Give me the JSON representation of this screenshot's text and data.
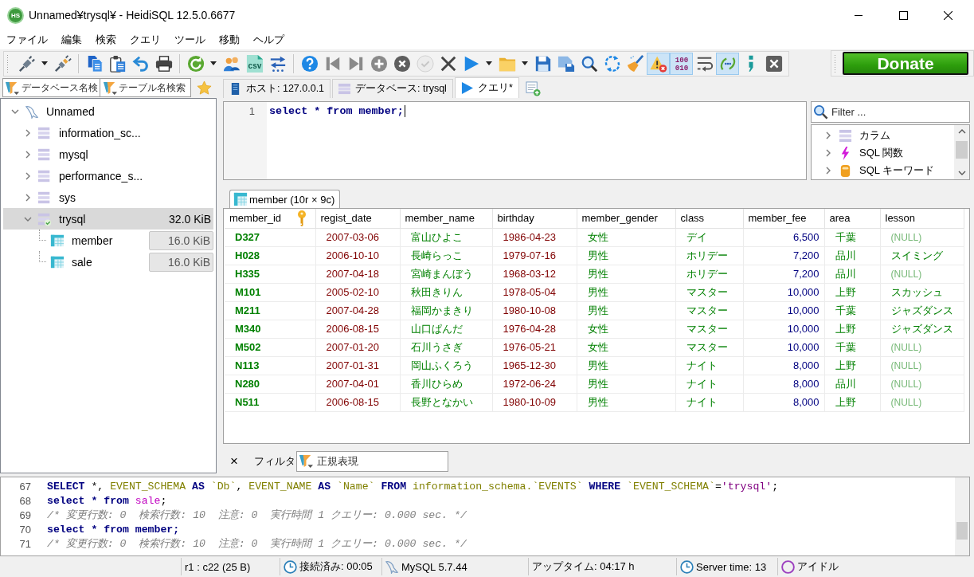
{
  "window": {
    "logo_text": "HS",
    "title": "Unnamed¥trysql¥ - HeidiSQL 12.5.0.6677"
  },
  "menu": [
    "ファイル",
    "編集",
    "検索",
    "クエリ",
    "ツール",
    "移動",
    "ヘルプ"
  ],
  "toolbar": {
    "groups": [
      [
        {
          "on": false,
          "disabled": false,
          "dropdown": true
        },
        {
          "on": false,
          "disabled": false,
          "dropdown": false
        }
      ],
      [
        {
          "on": false,
          "disabled": false,
          "dropdown": false
        },
        {
          "on": false,
          "disabled": false,
          "dropdown": false
        },
        {
          "on": false,
          "disabled": false,
          "dropdown": false
        },
        {
          "on": false,
          "disabled": false,
          "dropdown": false
        }
      ],
      [
        {
          "on": false,
          "disabled": false,
          "dropdown": true
        },
        {
          "on": false,
          "disabled": false,
          "dropdown": false
        },
        {
          "on": false,
          "disabled": false,
          "dropdown": false,
          "text_lines": [
            "csv"
          ]
        },
        {
          "on": false,
          "disabled": false,
          "dropdown": false
        }
      ],
      [
        {
          "on": false,
          "disabled": false,
          "dropdown": false
        },
        {
          "on": false,
          "disabled": false,
          "dropdown": false
        },
        {
          "on": false,
          "disabled": false,
          "dropdown": false
        },
        {
          "on": false,
          "disabled": false,
          "dropdown": false
        },
        {
          "on": false,
          "disabled": false,
          "dropdown": false
        },
        {
          "on": false,
          "disabled": true,
          "dropdown": false
        },
        {
          "on": false,
          "disabled": false,
          "dropdown": false
        },
        {
          "on": false,
          "disabled": false,
          "dropdown": true
        },
        {
          "on": false,
          "disabled": false,
          "dropdown": true
        },
        {
          "on": false,
          "disabled": false,
          "dropdown": false
        },
        {
          "on": false,
          "disabled": false,
          "dropdown": false
        },
        {
          "on": false,
          "disabled": false,
          "dropdown": false
        },
        {
          "on": false,
          "disabled": false,
          "dropdown": false
        },
        {
          "on": false,
          "disabled": false,
          "dropdown": false
        },
        {
          "on": true,
          "disabled": false,
          "dropdown": false
        },
        {
          "on": true,
          "disabled": false,
          "dropdown": false,
          "text_lines": [
            "100",
            "010"
          ]
        },
        {
          "on": false,
          "disabled": false,
          "dropdown": false
        },
        {
          "on": true,
          "disabled": false,
          "dropdown": false
        },
        {
          "on": false,
          "disabled": false,
          "dropdown": false
        },
        {
          "on": false,
          "disabled": false,
          "dropdown": false
        }
      ]
    ],
    "donate": "Donate"
  },
  "tree_filters": [
    {
      "placeholder": "データベース名検"
    },
    {
      "placeholder": "テーブル名検索"
    }
  ],
  "tabs": [
    {
      "kind": "host",
      "label": "ホスト: 127.0.0.1",
      "selected": false
    },
    {
      "kind": "database",
      "label": "データベース: trysql",
      "selected": false
    },
    {
      "kind": "query",
      "label": "クエリ*",
      "selected": true
    }
  ],
  "tree": {
    "kind": "server",
    "label": "Unnamed",
    "expanded": true,
    "selected": false,
    "children": [
      {
        "kind": "database",
        "label": "information_sc...",
        "expanded": false,
        "selected": false,
        "active": false
      },
      {
        "kind": "database",
        "label": "mysql",
        "expanded": false,
        "selected": false,
        "active": false
      },
      {
        "kind": "database",
        "label": "performance_s...",
        "expanded": false,
        "selected": false,
        "active": false
      },
      {
        "kind": "database",
        "label": "sys",
        "expanded": false,
        "selected": false,
        "active": false
      },
      {
        "kind": "database",
        "label": "trysql",
        "size": "32.0 KiB",
        "expanded": true,
        "selected": true,
        "active": true,
        "children": [
          {
            "kind": "table",
            "label": "member",
            "size": "16.0 KiB",
            "selected": false
          },
          {
            "kind": "table",
            "label": "sale",
            "size": "16.0 KiB",
            "selected": false
          }
        ]
      }
    ]
  },
  "editor": {
    "lines": [
      {
        "number": "1",
        "text": "select * from member;"
      }
    ]
  },
  "helper": {
    "filter": {
      "placeholder": "Filter ..."
    },
    "items": [
      {
        "kind": "columns",
        "label": "カラム",
        "expanded": false
      },
      {
        "kind": "functions",
        "label": "SQL 関数",
        "expanded": false
      },
      {
        "kind": "keywords",
        "label": "SQL キーワード",
        "expanded": false
      }
    ]
  },
  "results": {
    "tabs": [
      {
        "label": "member (10r × 9c)",
        "selected": true
      }
    ],
    "columns": [
      {
        "label": "member_id",
        "kind": "text",
        "primary_key": true
      },
      {
        "label": "regist_date",
        "kind": "date",
        "primary_key": false
      },
      {
        "label": "member_name",
        "kind": "text",
        "primary_key": false
      },
      {
        "label": "birthday",
        "kind": "date",
        "primary_key": false
      },
      {
        "label": "member_gender",
        "kind": "text",
        "primary_key": false
      },
      {
        "label": "class",
        "kind": "text",
        "primary_key": false
      },
      {
        "label": "member_fee",
        "kind": "number",
        "primary_key": false
      },
      {
        "label": "area",
        "kind": "text",
        "primary_key": false
      },
      {
        "label": "lesson",
        "kind": "text",
        "primary_key": false
      }
    ],
    "rows": [
      {
        "cells": [
          "D327",
          "2007-03-06",
          "富山ひよこ",
          "1986-04-23",
          "女性",
          "デイ",
          "6,500",
          "千葉",
          "(NULL)"
        ],
        "null": [
          false,
          false,
          false,
          false,
          false,
          false,
          false,
          false,
          true
        ]
      },
      {
        "cells": [
          "H028",
          "2006-10-10",
          "長崎らっこ",
          "1979-07-16",
          "男性",
          "ホリデー",
          "7,200",
          "品川",
          "スイミング"
        ],
        "null": [
          false,
          false,
          false,
          false,
          false,
          false,
          false,
          false,
          false
        ]
      },
      {
        "cells": [
          "H335",
          "2007-04-18",
          "宮崎まんぼう",
          "1968-03-12",
          "男性",
          "ホリデー",
          "7,200",
          "品川",
          "(NULL)"
        ],
        "null": [
          false,
          false,
          false,
          false,
          false,
          false,
          false,
          false,
          true
        ]
      },
      {
        "cells": [
          "M101",
          "2005-02-10",
          "秋田きりん",
          "1978-05-04",
          "男性",
          "マスター",
          "10,000",
          "上野",
          "スカッシュ"
        ],
        "null": [
          false,
          false,
          false,
          false,
          false,
          false,
          false,
          false,
          false
        ]
      },
      {
        "cells": [
          "M211",
          "2007-04-28",
          "福岡かまきり",
          "1980-10-08",
          "男性",
          "マスター",
          "10,000",
          "千葉",
          "ジャズダンス"
        ],
        "null": [
          false,
          false,
          false,
          false,
          false,
          false,
          false,
          false,
          false
        ]
      },
      {
        "cells": [
          "M340",
          "2006-08-15",
          "山口ぱんだ",
          "1976-04-28",
          "女性",
          "マスター",
          "10,000",
          "上野",
          "ジャズダンス"
        ],
        "null": [
          false,
          false,
          false,
          false,
          false,
          false,
          false,
          false,
          false
        ]
      },
      {
        "cells": [
          "M502",
          "2007-01-20",
          "石川うさぎ",
          "1976-05-21",
          "女性",
          "マスター",
          "10,000",
          "千葉",
          "(NULL)"
        ],
        "null": [
          false,
          false,
          false,
          false,
          false,
          false,
          false,
          false,
          true
        ]
      },
      {
        "cells": [
          "N113",
          "2007-01-31",
          "岡山ふくろう",
          "1965-12-30",
          "男性",
          "ナイト",
          "8,000",
          "上野",
          "(NULL)"
        ],
        "null": [
          false,
          false,
          false,
          false,
          false,
          false,
          false,
          false,
          true
        ]
      },
      {
        "cells": [
          "N280",
          "2007-04-01",
          "香川ひらめ",
          "1972-06-24",
          "男性",
          "ナイト",
          "8,000",
          "品川",
          "(NULL)"
        ],
        "null": [
          false,
          false,
          false,
          false,
          false,
          false,
          false,
          false,
          true
        ]
      },
      {
        "cells": [
          "N511",
          "2006-08-15",
          "長野となかい",
          "1980-10-09",
          "男性",
          "ナイト",
          "8,000",
          "上野",
          "(NULL)"
        ],
        "null": [
          false,
          false,
          false,
          false,
          false,
          false,
          false,
          false,
          true
        ]
      }
    ]
  },
  "filter_bar": {
    "close": "×",
    "label": "フィルタ",
    "field": {
      "placeholder": "正規表現"
    }
  },
  "log": {
    "lines": [
      {
        "number": "67",
        "tokens": [
          {
            "kind": "keyword",
            "text": "SELECT"
          },
          {
            "kind": "plain",
            "text": " *, "
          },
          {
            "kind": "identifier",
            "text": "EVENT_SCHEMA"
          },
          {
            "kind": "keyword",
            "text": " AS "
          },
          {
            "kind": "identifier",
            "text": "`Db`"
          },
          {
            "kind": "plain",
            "text": ", "
          },
          {
            "kind": "identifier",
            "text": "EVENT_NAME"
          },
          {
            "kind": "keyword",
            "text": " AS "
          },
          {
            "kind": "identifier",
            "text": "`Name`"
          },
          {
            "kind": "keyword",
            "text": " FROM "
          },
          {
            "kind": "identifier",
            "text": "information_schema.`EVENTS`"
          },
          {
            "kind": "keyword",
            "text": " WHERE "
          },
          {
            "kind": "identifier",
            "text": "`EVENT_SCHEMA`"
          },
          {
            "kind": "plain",
            "text": "="
          },
          {
            "kind": "string",
            "text": "'trysql'"
          },
          {
            "kind": "plain",
            "text": ";"
          }
        ]
      },
      {
        "number": "68",
        "tokens": [
          {
            "kind": "keyword",
            "text": "select * from "
          },
          {
            "kind": "table",
            "text": "sale"
          },
          {
            "kind": "plain",
            "text": ";"
          }
        ]
      },
      {
        "number": "69",
        "tokens": [
          {
            "kind": "comment",
            "text": "/* 変更行数: 0  検索行数: 10  注意: 0  実行時間 1 クエリー: 0.000 sec. */"
          }
        ]
      },
      {
        "number": "70",
        "tokens": [
          {
            "kind": "keyword",
            "text": "select * from member;"
          }
        ]
      },
      {
        "number": "71",
        "tokens": [
          {
            "kind": "comment",
            "text": "/* 変更行数: 0  検索行数: 10  注意: 0  実行時間 1 クエリー: 0.000 sec. */"
          }
        ]
      }
    ]
  },
  "status_bar": [
    {
      "kind": "plain",
      "text": "r1 : c22 (25 B)"
    },
    {
      "kind": "clock",
      "text": "接続済み: 00:05"
    },
    {
      "kind": "server",
      "text": "MySQL 5.7.44"
    },
    {
      "kind": "plain",
      "text": "アップタイム: 04:17 h"
    },
    {
      "kind": "clock",
      "text": "Server time: 13"
    },
    {
      "kind": "idle",
      "text": "アイドル"
    }
  ]
}
